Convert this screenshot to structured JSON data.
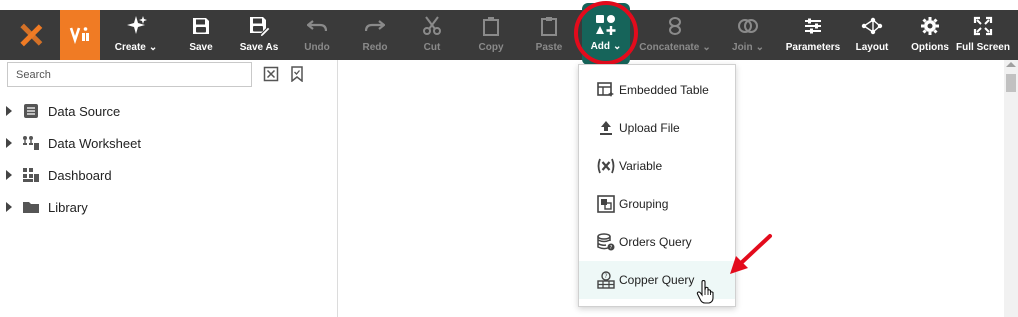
{
  "toolbar": {
    "items": [
      {
        "label": "Create",
        "icon": "create-icon",
        "has_caret": true
      },
      {
        "label": "Save",
        "icon": "save-icon"
      },
      {
        "label": "Save As",
        "icon": "save-as-icon"
      },
      {
        "label": "Undo",
        "icon": "undo-icon",
        "disabled": true
      },
      {
        "label": "Redo",
        "icon": "redo-icon",
        "disabled": true
      },
      {
        "label": "Cut",
        "icon": "cut-icon",
        "disabled": true
      },
      {
        "label": "Copy",
        "icon": "copy-icon",
        "disabled": true
      },
      {
        "label": "Paste",
        "icon": "paste-icon",
        "disabled": true
      },
      {
        "label": "Add",
        "icon": "add-icon",
        "has_caret": true,
        "active": true
      },
      {
        "label": "Concatenate",
        "icon": "concatenate-icon",
        "has_caret": true,
        "disabled": true
      },
      {
        "label": "Join",
        "icon": "join-icon",
        "has_caret": true,
        "disabled": true
      },
      {
        "label": "Parameters",
        "icon": "parameters-icon"
      },
      {
        "label": "Layout",
        "icon": "layout-icon"
      },
      {
        "label": "Options",
        "icon": "gear-icon"
      },
      {
        "label": "Full Screen",
        "icon": "fullscreen-icon"
      }
    ]
  },
  "sidebar": {
    "search_placeholder": "Search",
    "tree": [
      {
        "label": "Data Source",
        "icon": "data-source-icon"
      },
      {
        "label": "Data Worksheet",
        "icon": "data-worksheet-icon"
      },
      {
        "label": "Dashboard",
        "icon": "dashboard-icon"
      },
      {
        "label": "Library",
        "icon": "folder-icon"
      }
    ]
  },
  "add_menu": {
    "items": [
      {
        "label": "Embedded Table",
        "icon": "embedded-table-icon"
      },
      {
        "label": "Upload File",
        "icon": "upload-icon"
      },
      {
        "label": "Variable",
        "icon": "variable-icon"
      },
      {
        "label": "Grouping",
        "icon": "grouping-icon"
      },
      {
        "label": "Orders Query",
        "icon": "database-query-icon"
      },
      {
        "label": "Copper Query",
        "icon": "query-table-icon",
        "hovered": true
      }
    ]
  },
  "colors": {
    "toolbar_bg": "#3a3a3a",
    "brand_orange": "#f07b24",
    "add_active_bg": "#16645a",
    "annotation_red": "#e30b1c",
    "hover_bg": "#eef8f7"
  }
}
